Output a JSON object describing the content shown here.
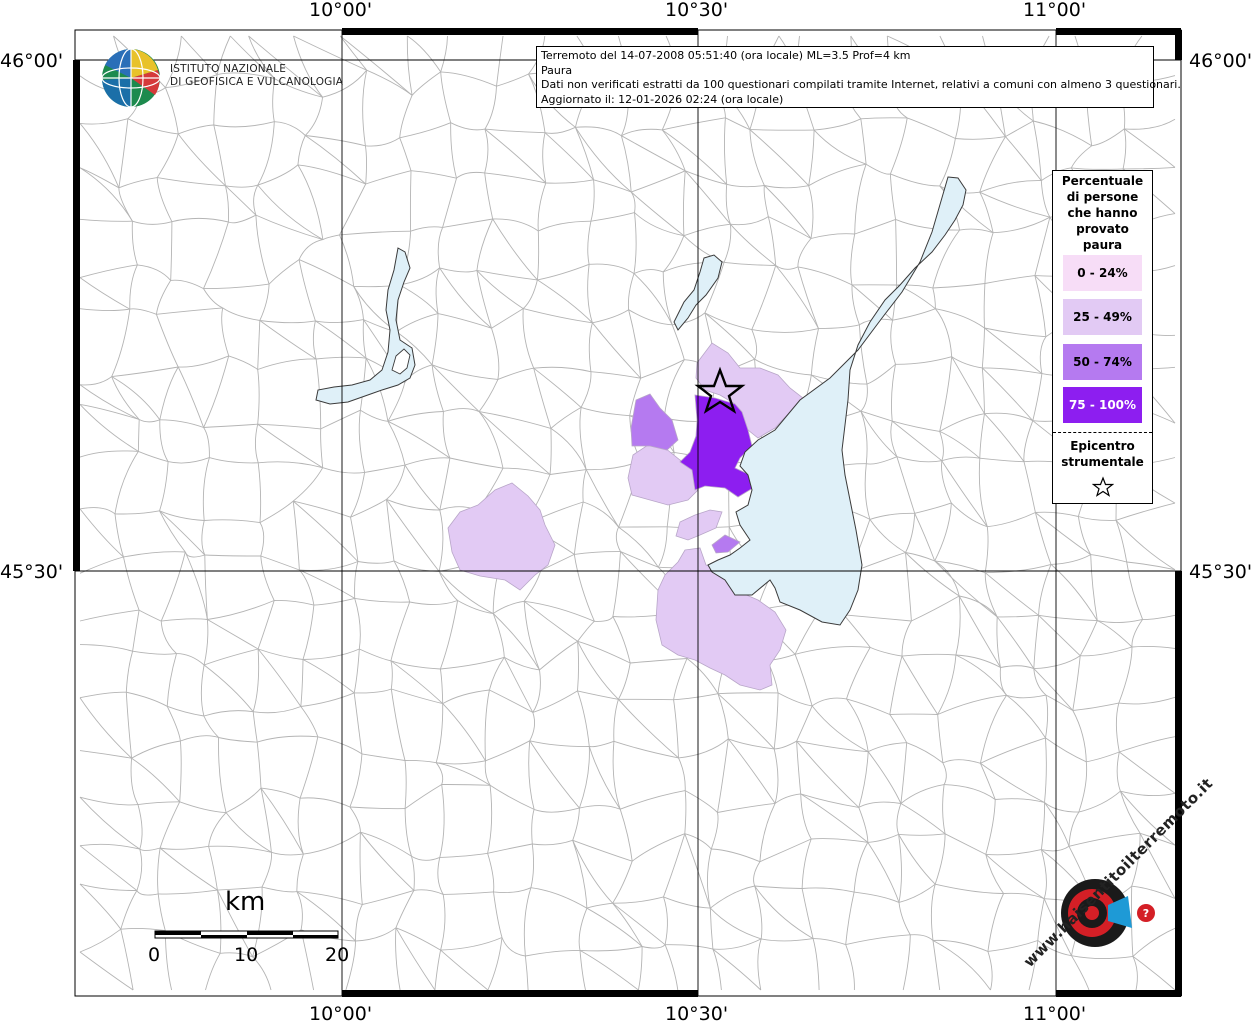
{
  "info": {
    "line1": "Terremoto del 14-07-2008 05:51:40 (ora locale) ML=3.5 Prof=4 km",
    "line2": "Paura",
    "line3": "Dati non verificati estratti da 100 questionari compilati tramite Internet, relativi a comuni con almeno 3 questionari.",
    "line4": "Aggiornato il: 12-01-2026 02:24 (ora locale)"
  },
  "logo": {
    "line1": "ISTITUTO NAZIONALE",
    "line2": "DI GEOFISICA E VULCANOLOGIA"
  },
  "coords": {
    "top": [
      "10°00'",
      "10°30'",
      "11°00'"
    ],
    "bottom": [
      "10°00'",
      "10°30'",
      "11°00'"
    ],
    "left": [
      "46°00'",
      "45°30'"
    ],
    "right": [
      "46°00'",
      "45°30'"
    ]
  },
  "legend": {
    "title": [
      "Percentuale",
      "di persone",
      "che hanno",
      "provato",
      "paura"
    ],
    "classes": [
      {
        "label": "0 - 24%",
        "color": "#f7ddf7",
        "text_color": "#000000"
      },
      {
        "label": "25 - 49%",
        "color": "#e2caf4",
        "text_color": "#000000"
      },
      {
        "label": "50 - 74%",
        "color": "#b57af0",
        "text_color": "#000000"
      },
      {
        "label": "75 - 100%",
        "color": "#8d1ef0",
        "text_color": "#ffffff"
      }
    ],
    "epicenter_label": [
      "Epicentro",
      "strumentale"
    ]
  },
  "scale": {
    "unit": "km",
    "ticks": [
      "0",
      "10",
      "20"
    ]
  },
  "watermark": {
    "text": "www.haisentitoilterremoto.it"
  },
  "colors": {
    "lake": "#dff0f8",
    "border": "#aaaaaa"
  }
}
